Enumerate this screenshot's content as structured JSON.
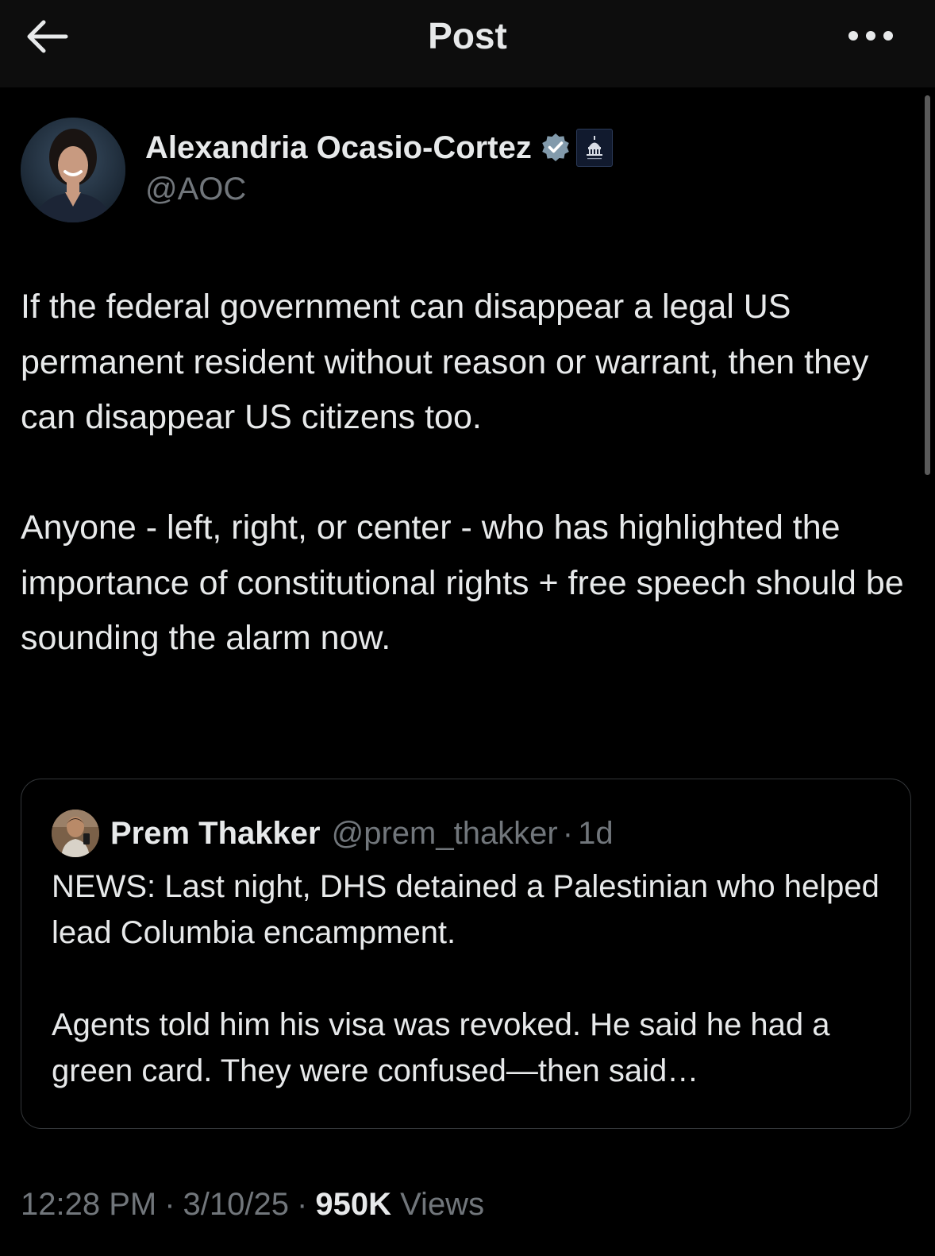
{
  "header": {
    "title": "Post"
  },
  "author": {
    "display_name": "Alexandria Ocasio-Cortez",
    "handle": "@AOC"
  },
  "post": {
    "paragraphs": [
      "If the federal government can disappear a legal US permanent resident without reason or warrant, then they can disappear US citizens too.",
      "Anyone - left, right, or center - who has highlighted the importance of constitutional rights + free speech should be sounding the alarm now."
    ]
  },
  "quote": {
    "display_name": "Prem Thakker",
    "handle": "@prem_thakker",
    "separator": "·",
    "time": "1d",
    "paragraphs": [
      "NEWS: Last night, DHS detained a Palestinian who helped lead Columbia encampment.",
      "Agents told him his visa was revoked. He said he had a green card. They were confused—then said…"
    ]
  },
  "meta": {
    "time": "12:28 PM",
    "date": "3/10/25",
    "separator": "·",
    "views_count": "950K",
    "views_label": "Views"
  },
  "colors": {
    "background": "#000000",
    "topbar": "#0d0d0d",
    "text_primary": "#e7e9ea",
    "text_secondary": "#71767b",
    "verified": "#829aab",
    "border": "#333639"
  },
  "icons": {
    "back": "arrow-left-icon",
    "more": "more-horizontal-icon",
    "verified": "verified-badge-icon",
    "affiliation": "capitol-building-icon"
  }
}
